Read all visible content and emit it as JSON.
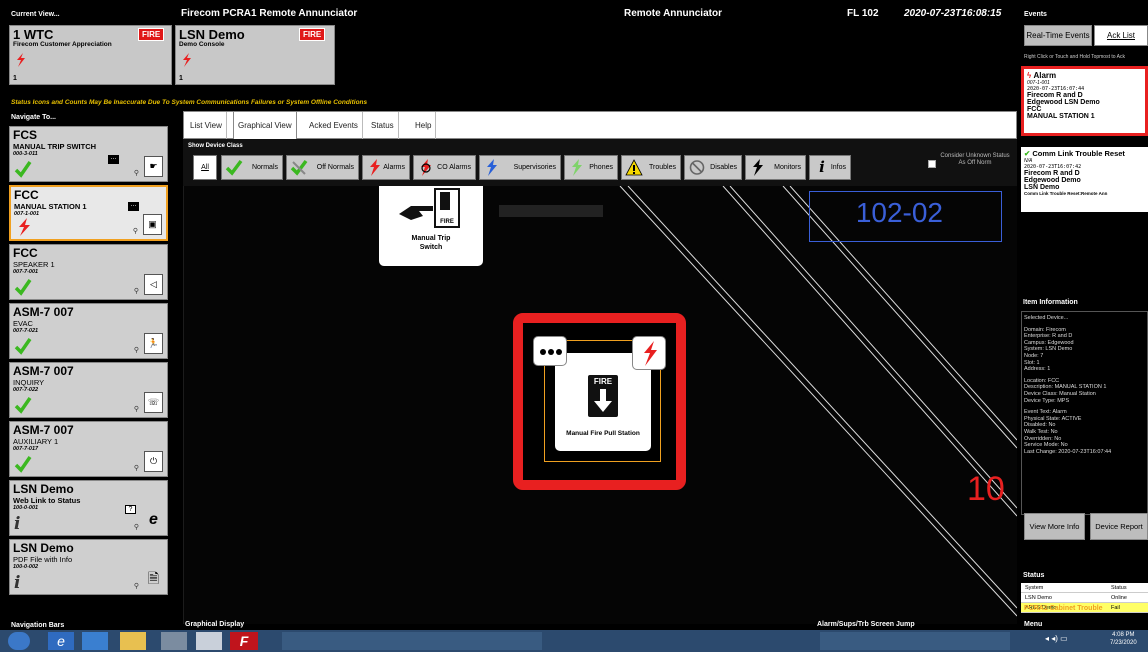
{
  "header": {
    "current_view_label": "Current View...",
    "app_title": "Firecom PCRA1 Remote Annunciator",
    "mode": "Remote Annunciator",
    "floor": "FL 102",
    "timestamp": "2020-07-23T16:08:15",
    "events_label": "Events"
  },
  "summary_cards": [
    {
      "title": "1 WTC",
      "sub": "Firecom Customer Appreciation",
      "badge": "FIRE",
      "count": "1"
    },
    {
      "title": "LSN Demo",
      "sub": "Demo Console",
      "badge": "FIRE",
      "count": "1"
    }
  ],
  "warning": "Status Icons and Counts May Be Inaccurate Due To System Communications Failures or System Offline Conditions",
  "navigate_label": "Navigate To...",
  "nav_items": [
    {
      "title": "FCS",
      "desc": "MANUAL TRIP SWITCH",
      "addr": "000-3-011",
      "status": "ok",
      "device": "manual-trip-switch"
    },
    {
      "title": "FCC",
      "desc": "MANUAL STATION 1",
      "addr": "007-1-001",
      "status": "alarm",
      "device": "manual-station",
      "selected": true
    },
    {
      "title": "FCC",
      "desc": "SPEAKER 1",
      "addr": "007-7-001",
      "status": "ok",
      "device": "speaker"
    },
    {
      "title": "ASM-7 007",
      "desc": "EVAC",
      "addr": "007-7-021",
      "status": "ok",
      "device": "evacuation"
    },
    {
      "title": "ASM-7 007",
      "desc": "INQUIRY",
      "addr": "007-7-022",
      "status": "ok",
      "device": "inquiry"
    },
    {
      "title": "ASM-7 007",
      "desc": "AUXILIARY 1",
      "addr": "007-7-017",
      "status": "ok",
      "device": "auxiliary"
    },
    {
      "title": "LSN Demo",
      "desc": "Web Link to Status",
      "addr": "100-0-001",
      "status": "info",
      "device": "web-link"
    },
    {
      "title": "LSN Demo",
      "desc": "PDF File with Info",
      "addr": "100-0-002",
      "status": "info",
      "device": "pdf-file"
    }
  ],
  "tabs": [
    "List View",
    "Graphical View",
    "Acked Events",
    "Status",
    "Help"
  ],
  "active_tab": "Graphical View",
  "show_device_class_label": "Show Device Class",
  "device_classes": [
    "All",
    "Normals",
    "Off Normals",
    "Alarms",
    "CO Alarms",
    "Supervisories",
    "Phones",
    "Troubles",
    "Disables",
    "Monitors",
    "Infos"
  ],
  "consider_unknown": "Consider Unknown Status As Off Norm",
  "graphic": {
    "room_number": "102-02",
    "side_number": "10",
    "manual_trip_label": "Manual Trip Switch",
    "fire_label": "FIRE",
    "pull_station_label": "Manual Fire Pull Station"
  },
  "right_panel": {
    "realtime_button": "Real-Time Events",
    "ack_list_button": "Ack List",
    "hint": "Right Click or Touch and Hold Topmost to Ack",
    "events": [
      {
        "type": "Alarm",
        "addr": "007-1-001",
        "time": "2020-07-23T16:07:44",
        "lines": [
          "Firecom R and D",
          "Edgewood LSN Demo",
          "FCC",
          "MANUAL STATION 1"
        ]
      },
      {
        "type": "Comm Link Trouble Reset",
        "addr": "N/A",
        "time": "2020-07-23T16:07:42",
        "lines": [
          "Firecom R and D",
          "Edgewood Demo",
          "LSN Demo",
          "Comm Link Trouble Reset:Remote Ann"
        ]
      }
    ],
    "item_info_label": "Item Information",
    "item_info": [
      "Selected Device...",
      "",
      "Domain: Firecom",
      "Enterprise: R and D",
      "Campus: Edgewood",
      "System: LSN Demo",
      "Node: 7",
      "Slot: 1",
      "Address: 1",
      "",
      "Location: FCC",
      "Description: MANUAL STATION 1",
      "Device Class: Manual Station",
      "Device Type: MPS",
      "",
      "Event Text: Alarm",
      "Physical State: ACTIVE",
      "Disabled: No",
      "Walk Test: No",
      "Overridden: No",
      "Service Mode: No",
      "Last Change: 2020-07-23T16:07:44"
    ],
    "view_more_button": "View More Info",
    "device_report_button": "Device Report",
    "status_label": "Status",
    "status_headers": [
      "System",
      "Status"
    ],
    "status_rows": [
      {
        "system": "LSN Demo",
        "status": "Online",
        "color": "#ffffff"
      },
      {
        "system": "ARCS Demo",
        "status": "Fail",
        "color": "#ffff66"
      }
    ],
    "cabinet_trouble": "PCRA1 Cabinet Trouble",
    "menu_label": "Menu"
  },
  "bottom_labels": {
    "nav_bars": "Navigation Bars",
    "graphical_display": "Graphical Display",
    "screen_jump": "Alarm/Sups/Trb Screen Jump"
  },
  "taskbar": {
    "time": "4:08 PM",
    "date": "7/23/2020"
  },
  "colors": {
    "alarm": "#e82020",
    "ok": "#3bb820",
    "accent_orange": "#f0a020",
    "room_blue": "#3a5fd8"
  }
}
